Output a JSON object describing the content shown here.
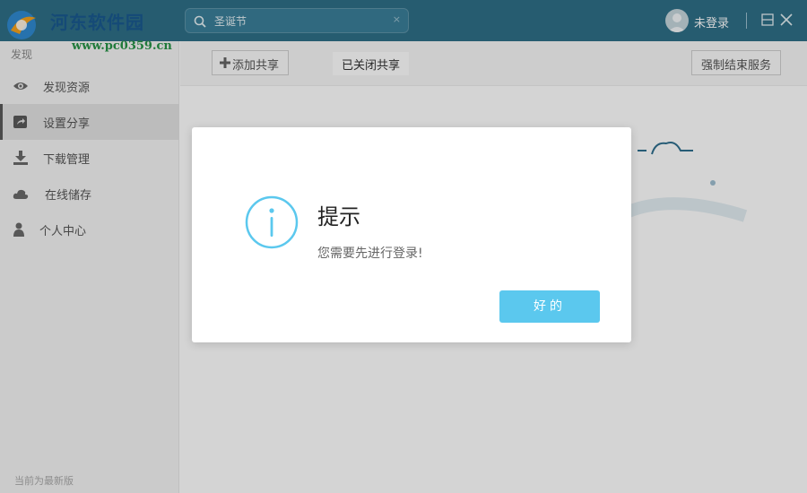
{
  "titlebar": {
    "brand": "河东软件园",
    "brand_url": "www.pc0359.cn",
    "search_value": "圣诞节",
    "search_clear": "×",
    "user_label": "未登录",
    "icons": {
      "search": "search-icon",
      "user": "user-avatar-icon",
      "minimize": "minimize-icon",
      "close": "close-icon"
    }
  },
  "sidebar": {
    "header": "发现",
    "items": [
      {
        "label": "发现资源",
        "icon": "eye-icon"
      },
      {
        "label": "设置分享",
        "icon": "share-icon",
        "active": true
      },
      {
        "label": "下载管理",
        "icon": "download-icon"
      },
      {
        "label": "在线储存",
        "icon": "cloud-icon"
      },
      {
        "label": "个人中心",
        "icon": "person-icon"
      }
    ],
    "footer": "当前为最新版"
  },
  "toolbar": {
    "add_share": "添加共享",
    "closed_share": "已关闭共享",
    "force_stop": "强制结束服务"
  },
  "dialog": {
    "title": "提示",
    "message": "您需要先进行登录!",
    "ok_label": "好的",
    "accent": "#5bc8ee"
  }
}
